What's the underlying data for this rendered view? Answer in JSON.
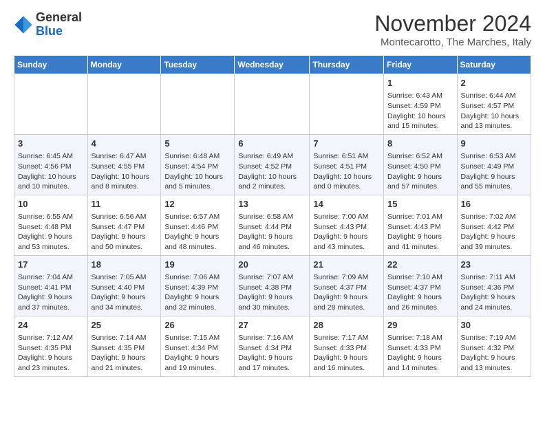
{
  "header": {
    "logo_general": "General",
    "logo_blue": "Blue",
    "month_title": "November 2024",
    "subtitle": "Montecarotto, The Marches, Italy"
  },
  "weekdays": [
    "Sunday",
    "Monday",
    "Tuesday",
    "Wednesday",
    "Thursday",
    "Friday",
    "Saturday"
  ],
  "weeks": [
    [
      {
        "day": "",
        "info": ""
      },
      {
        "day": "",
        "info": ""
      },
      {
        "day": "",
        "info": ""
      },
      {
        "day": "",
        "info": ""
      },
      {
        "day": "",
        "info": ""
      },
      {
        "day": "1",
        "info": "Sunrise: 6:43 AM\nSunset: 4:59 PM\nDaylight: 10 hours and 15 minutes."
      },
      {
        "day": "2",
        "info": "Sunrise: 6:44 AM\nSunset: 4:57 PM\nDaylight: 10 hours and 13 minutes."
      }
    ],
    [
      {
        "day": "3",
        "info": "Sunrise: 6:45 AM\nSunset: 4:56 PM\nDaylight: 10 hours and 10 minutes."
      },
      {
        "day": "4",
        "info": "Sunrise: 6:47 AM\nSunset: 4:55 PM\nDaylight: 10 hours and 8 minutes."
      },
      {
        "day": "5",
        "info": "Sunrise: 6:48 AM\nSunset: 4:54 PM\nDaylight: 10 hours and 5 minutes."
      },
      {
        "day": "6",
        "info": "Sunrise: 6:49 AM\nSunset: 4:52 PM\nDaylight: 10 hours and 2 minutes."
      },
      {
        "day": "7",
        "info": "Sunrise: 6:51 AM\nSunset: 4:51 PM\nDaylight: 10 hours and 0 minutes."
      },
      {
        "day": "8",
        "info": "Sunrise: 6:52 AM\nSunset: 4:50 PM\nDaylight: 9 hours and 57 minutes."
      },
      {
        "day": "9",
        "info": "Sunrise: 6:53 AM\nSunset: 4:49 PM\nDaylight: 9 hours and 55 minutes."
      }
    ],
    [
      {
        "day": "10",
        "info": "Sunrise: 6:55 AM\nSunset: 4:48 PM\nDaylight: 9 hours and 53 minutes."
      },
      {
        "day": "11",
        "info": "Sunrise: 6:56 AM\nSunset: 4:47 PM\nDaylight: 9 hours and 50 minutes."
      },
      {
        "day": "12",
        "info": "Sunrise: 6:57 AM\nSunset: 4:46 PM\nDaylight: 9 hours and 48 minutes."
      },
      {
        "day": "13",
        "info": "Sunrise: 6:58 AM\nSunset: 4:44 PM\nDaylight: 9 hours and 46 minutes."
      },
      {
        "day": "14",
        "info": "Sunrise: 7:00 AM\nSunset: 4:43 PM\nDaylight: 9 hours and 43 minutes."
      },
      {
        "day": "15",
        "info": "Sunrise: 7:01 AM\nSunset: 4:43 PM\nDaylight: 9 hours and 41 minutes."
      },
      {
        "day": "16",
        "info": "Sunrise: 7:02 AM\nSunset: 4:42 PM\nDaylight: 9 hours and 39 minutes."
      }
    ],
    [
      {
        "day": "17",
        "info": "Sunrise: 7:04 AM\nSunset: 4:41 PM\nDaylight: 9 hours and 37 minutes."
      },
      {
        "day": "18",
        "info": "Sunrise: 7:05 AM\nSunset: 4:40 PM\nDaylight: 9 hours and 34 minutes."
      },
      {
        "day": "19",
        "info": "Sunrise: 7:06 AM\nSunset: 4:39 PM\nDaylight: 9 hours and 32 minutes."
      },
      {
        "day": "20",
        "info": "Sunrise: 7:07 AM\nSunset: 4:38 PM\nDaylight: 9 hours and 30 minutes."
      },
      {
        "day": "21",
        "info": "Sunrise: 7:09 AM\nSunset: 4:37 PM\nDaylight: 9 hours and 28 minutes."
      },
      {
        "day": "22",
        "info": "Sunrise: 7:10 AM\nSunset: 4:37 PM\nDaylight: 9 hours and 26 minutes."
      },
      {
        "day": "23",
        "info": "Sunrise: 7:11 AM\nSunset: 4:36 PM\nDaylight: 9 hours and 24 minutes."
      }
    ],
    [
      {
        "day": "24",
        "info": "Sunrise: 7:12 AM\nSunset: 4:35 PM\nDaylight: 9 hours and 23 minutes."
      },
      {
        "day": "25",
        "info": "Sunrise: 7:14 AM\nSunset: 4:35 PM\nDaylight: 9 hours and 21 minutes."
      },
      {
        "day": "26",
        "info": "Sunrise: 7:15 AM\nSunset: 4:34 PM\nDaylight: 9 hours and 19 minutes."
      },
      {
        "day": "27",
        "info": "Sunrise: 7:16 AM\nSunset: 4:34 PM\nDaylight: 9 hours and 17 minutes."
      },
      {
        "day": "28",
        "info": "Sunrise: 7:17 AM\nSunset: 4:33 PM\nDaylight: 9 hours and 16 minutes."
      },
      {
        "day": "29",
        "info": "Sunrise: 7:18 AM\nSunset: 4:33 PM\nDaylight: 9 hours and 14 minutes."
      },
      {
        "day": "30",
        "info": "Sunrise: 7:19 AM\nSunset: 4:32 PM\nDaylight: 9 hours and 13 minutes."
      }
    ]
  ]
}
